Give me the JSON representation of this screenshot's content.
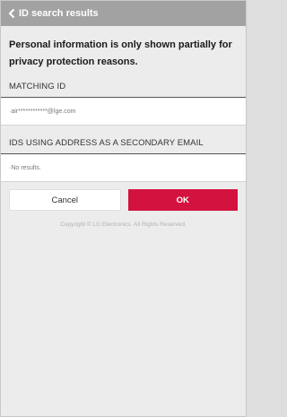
{
  "header": {
    "title": "ID search results",
    "back_icon": "chevron-left-icon"
  },
  "notice": "Personal information is only shown partially for privacy protection reasons.",
  "matching": {
    "label": "MATCHING ID",
    "value": "·air************@lge.com"
  },
  "secondary": {
    "label": "IDS USING ADDRESS AS A SECONDARY EMAIL",
    "value": "·No results."
  },
  "buttons": {
    "cancel": "Cancel",
    "ok": "OK"
  },
  "footer": {
    "copyright": "Copyright © LG Electronics. All Rights Reserved."
  },
  "colors": {
    "header_bg": "#a2a2a2",
    "accent": "#d3123f"
  }
}
